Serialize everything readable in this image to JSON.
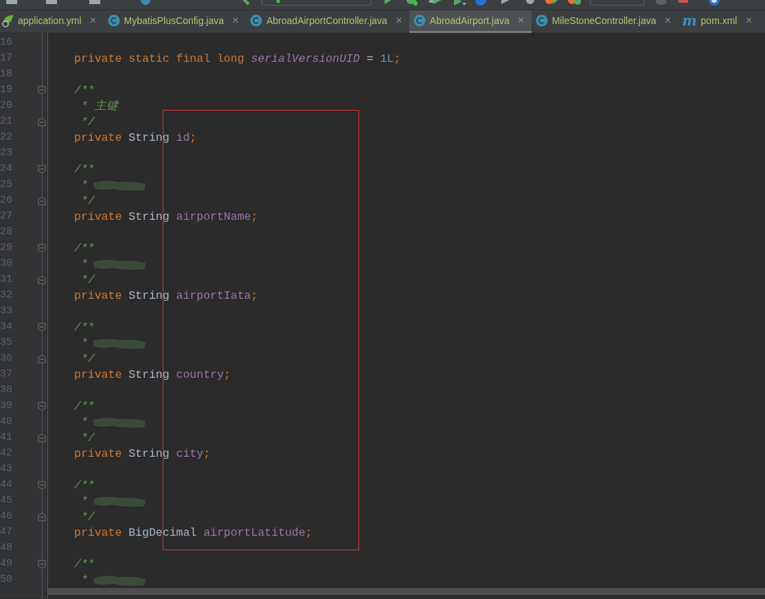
{
  "tabs": [
    {
      "label": "application.yml",
      "kind": "spring",
      "close": "×",
      "selected": false
    },
    {
      "label": "MybatisPlusConfig.java",
      "kind": "class",
      "close": "×",
      "selected": false
    },
    {
      "label": "AbroadAirportController.java",
      "kind": "class",
      "close": "×",
      "selected": false
    },
    {
      "label": "AbroadAirport.java",
      "kind": "class",
      "close": "×",
      "selected": true
    },
    {
      "label": "MileStoneController.java",
      "kind": "class",
      "close": "×",
      "selected": false
    },
    {
      "label": "pom.xml",
      "kind": "maven",
      "icon_text": "m",
      "close": "×",
      "selected": false
    }
  ],
  "editor": {
    "lines": [
      {
        "number": "16",
        "kind": "blank"
      },
      {
        "number": "17",
        "kind": "code",
        "tokens": [
          {
            "kind": "keyword",
            "text": "private static final long "
          },
          {
            "kind": "constant",
            "text": "serialVersionUID"
          },
          {
            "kind": "plain",
            "text": " = "
          },
          {
            "kind": "number",
            "text": "1L"
          },
          {
            "kind": "keyword",
            "text": ";"
          }
        ]
      },
      {
        "number": "18",
        "kind": "blank"
      },
      {
        "number": "19",
        "kind": "doc-open",
        "foldable": true,
        "tokens": [
          {
            "kind": "comment",
            "text": "/**"
          }
        ]
      },
      {
        "number": "20",
        "kind": "doc-body",
        "tokens": [
          {
            "kind": "comment",
            "text": "* 主键"
          }
        ]
      },
      {
        "number": "21",
        "kind": "doc-close",
        "foldable": true,
        "tokens": [
          {
            "kind": "comment",
            "text": "*/"
          }
        ]
      },
      {
        "number": "22",
        "kind": "code",
        "tokens": [
          {
            "kind": "keyword",
            "text": "private "
          },
          {
            "kind": "type",
            "text": "String "
          },
          {
            "kind": "field",
            "text": "id"
          },
          {
            "kind": "keyword",
            "text": ";"
          }
        ]
      },
      {
        "number": "23",
        "kind": "blank"
      },
      {
        "number": "24",
        "kind": "doc-open",
        "foldable": true,
        "tokens": [
          {
            "kind": "comment",
            "text": "/**"
          }
        ]
      },
      {
        "number": "25",
        "kind": "doc-body",
        "redacted": true,
        "tokens": [
          {
            "kind": "comment",
            "text": "*"
          }
        ]
      },
      {
        "number": "26",
        "kind": "doc-close",
        "foldable": true,
        "tokens": [
          {
            "kind": "comment",
            "text": "*/"
          }
        ]
      },
      {
        "number": "27",
        "kind": "code",
        "tokens": [
          {
            "kind": "keyword",
            "text": "private "
          },
          {
            "kind": "type",
            "text": "String "
          },
          {
            "kind": "field",
            "text": "airportName"
          },
          {
            "kind": "keyword",
            "text": ";"
          }
        ]
      },
      {
        "number": "28",
        "kind": "blank"
      },
      {
        "number": "29",
        "kind": "doc-open",
        "foldable": true,
        "tokens": [
          {
            "kind": "comment",
            "text": "/**"
          }
        ]
      },
      {
        "number": "30",
        "kind": "doc-body",
        "redacted": true,
        "tokens": [
          {
            "kind": "comment",
            "text": "*"
          }
        ]
      },
      {
        "number": "31",
        "kind": "doc-close",
        "foldable": true,
        "tokens": [
          {
            "kind": "comment",
            "text": "*/"
          }
        ]
      },
      {
        "number": "32",
        "kind": "code",
        "tokens": [
          {
            "kind": "keyword",
            "text": "private "
          },
          {
            "kind": "type",
            "text": "String "
          },
          {
            "kind": "field",
            "text": "airportIata"
          },
          {
            "kind": "keyword",
            "text": ";"
          }
        ]
      },
      {
        "number": "33",
        "kind": "blank"
      },
      {
        "number": "34",
        "kind": "doc-open",
        "foldable": true,
        "tokens": [
          {
            "kind": "comment",
            "text": "/**"
          }
        ]
      },
      {
        "number": "35",
        "kind": "doc-body",
        "redacted": true,
        "tokens": [
          {
            "kind": "comment",
            "text": "*"
          }
        ]
      },
      {
        "number": "36",
        "kind": "doc-close",
        "foldable": true,
        "tokens": [
          {
            "kind": "comment",
            "text": "*/"
          }
        ]
      },
      {
        "number": "37",
        "kind": "code",
        "tokens": [
          {
            "kind": "keyword",
            "text": "private "
          },
          {
            "kind": "type",
            "text": "String "
          },
          {
            "kind": "field",
            "text": "country"
          },
          {
            "kind": "keyword",
            "text": ";"
          }
        ]
      },
      {
        "number": "38",
        "kind": "blank"
      },
      {
        "number": "39",
        "kind": "doc-open",
        "foldable": true,
        "tokens": [
          {
            "kind": "comment",
            "text": "/**"
          }
        ]
      },
      {
        "number": "40",
        "kind": "doc-body",
        "redacted": true,
        "tokens": [
          {
            "kind": "comment",
            "text": "*"
          }
        ]
      },
      {
        "number": "41",
        "kind": "doc-close",
        "foldable": true,
        "tokens": [
          {
            "kind": "comment",
            "text": "*/"
          }
        ]
      },
      {
        "number": "42",
        "kind": "code",
        "tokens": [
          {
            "kind": "keyword",
            "text": "private "
          },
          {
            "kind": "type",
            "text": "String "
          },
          {
            "kind": "field",
            "text": "city"
          },
          {
            "kind": "keyword",
            "text": ";"
          }
        ]
      },
      {
        "number": "43",
        "kind": "blank"
      },
      {
        "number": "44",
        "kind": "doc-open",
        "foldable": true,
        "tokens": [
          {
            "kind": "comment",
            "text": "/**"
          }
        ]
      },
      {
        "number": "45",
        "kind": "doc-body",
        "redacted": true,
        "tokens": [
          {
            "kind": "comment",
            "text": "*"
          }
        ]
      },
      {
        "number": "46",
        "kind": "doc-close",
        "foldable": true,
        "tokens": [
          {
            "kind": "comment",
            "text": "*/"
          }
        ]
      },
      {
        "number": "47",
        "kind": "code",
        "tokens": [
          {
            "kind": "keyword",
            "text": "private "
          },
          {
            "kind": "type",
            "text": "BigDecimal "
          },
          {
            "kind": "field",
            "text": "airportLatitude"
          },
          {
            "kind": "keyword",
            "text": ";"
          }
        ]
      },
      {
        "number": "48",
        "kind": "blank"
      },
      {
        "number": "49",
        "kind": "doc-open",
        "foldable": true,
        "tokens": [
          {
            "kind": "comment",
            "text": "/**"
          }
        ]
      },
      {
        "number": "50",
        "kind": "doc-body",
        "redacted": true,
        "tokens": [
          {
            "kind": "comment",
            "text": "*"
          }
        ]
      }
    ]
  }
}
